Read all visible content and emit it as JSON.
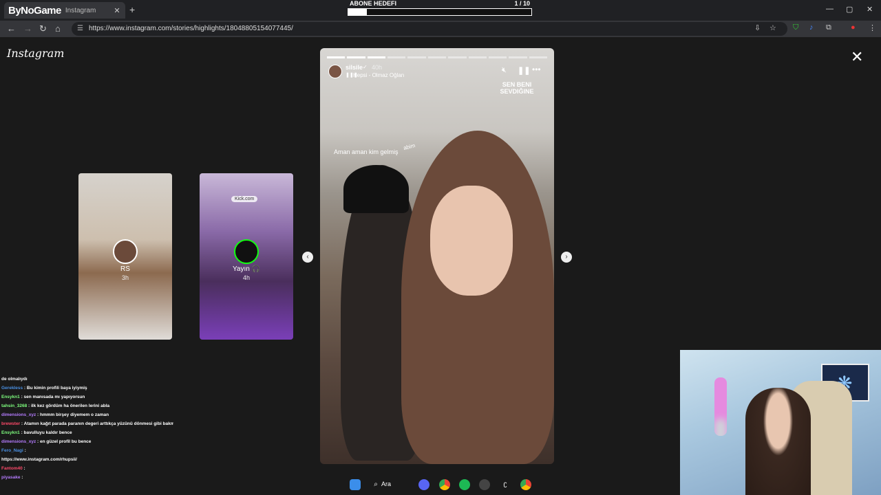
{
  "browser": {
    "tab_logo": "ByNoGame",
    "tab_title": "Instagram",
    "tab_close": "✕",
    "new_tab": "+",
    "url": "https://www.instagram.com/stories/highlights/18048805154077445/",
    "window_controls": [
      "—",
      "▢",
      "✕"
    ]
  },
  "goal": {
    "label": "ABONE HEDEFI",
    "count": "1  / 10",
    "progress": 0.1
  },
  "instagram": {
    "logo": "Instagram",
    "close": "✕",
    "side_stories": [
      {
        "name": "RS",
        "time": "3h"
      },
      {
        "name": "Yayın 🎧",
        "time": "4h",
        "tag": "Kick.com"
      }
    ],
    "main_story": {
      "user": "silsile",
      "verified": "✓",
      "time": "40h",
      "music_icon": "❚❚❚",
      "music": "Hepsi - Olmaz Oğlan",
      "sticker": "SEN BENI SEVDIĞINE",
      "caption": "Aman aman kim gelmiş",
      "caption2": "abim",
      "segments_total": 11,
      "segments_done": 3
    },
    "prev_arrow": "‹",
    "next_arrow": "›"
  },
  "chat": [
    {
      "user": "",
      "text": "de olmalıydı",
      "color": "#ffffff"
    },
    {
      "user": "Gerekless",
      "text": ": Bu kimin profili baya iyiymiş",
      "color": "#4a90e2"
    },
    {
      "user": "Ensykn1",
      "text": ": sen manısada mı yapıyorsun",
      "color": "#7fff7f"
    },
    {
      "user": "tahsin_3268",
      "text": ": ilk kez gördüm ha önerilen lerini abla",
      "color": "#7fff7f"
    },
    {
      "user": "dimensions_xyz",
      "text": ": hmmm birşey diyemem o zaman",
      "color": "#b57cff"
    },
    {
      "user": "brewster",
      "text": ": Atamın kağıt parada paranın degeri arttıkça yüzünü dönmesi gibi bakmuşsın sonay",
      "color": "#ff4a6a"
    },
    {
      "user": "Ensykn1",
      "text": ": bavulluyu kaldır bence",
      "color": "#7fff7f"
    },
    {
      "user": "dimensions_xyz",
      "text": ": en güzel profil bu bence",
      "color": "#b57cff"
    },
    {
      "user": "Fero_Nagi",
      "text": ":",
      "color": "#4a90e2"
    },
    {
      "user": "",
      "text": "https://www.instagram.com/rhupsii/",
      "color": "#ffffff"
    },
    {
      "user": "Fantom40",
      "text": ":",
      "color": "#ff4a6a"
    },
    {
      "user": "piyasake",
      "text": ":",
      "color": "#b57cff"
    }
  ],
  "taskbar": {
    "search": "Ara"
  }
}
